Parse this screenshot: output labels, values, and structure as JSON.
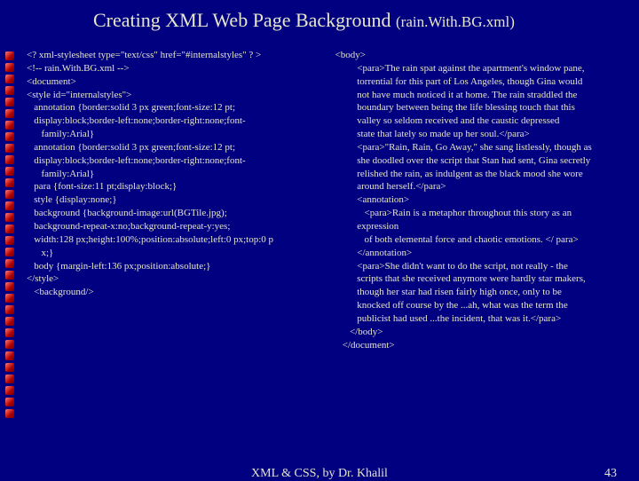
{
  "title_main": "Creating XML Web Page Background ",
  "title_sub": "(rain.With.BG.xml)",
  "left_col": "<? xml-stylesheet type=\"text/css\" href=\"#internalstyles\" ? >\n<!-- rain.With.BG.xml -->\n<document>\n<style id=\"internalstyles\">\n   annotation {border:solid 3 px green;font-size:12 pt;\n   display:block;border-left:none;border-right:none;font-\n      family:Arial}\n   annotation {border:solid 3 px green;font-size:12 pt;\n   display:block;border-left:none;border-right:none;font-\n      family:Arial}\n   para {font-size:11 pt;display:block;}\n   style {display:none;}\n   background {background-image:url(BGTile.jpg);\n   background-repeat-x:no;background-repeat-y:yes;\n   width:128 px;height:100%;position:absolute;left:0 px;top:0 p\n      x;}\n   body {margin-left:136 px;position:absolute;}\n</style>\n   <background/>",
  "right_col": "<body>\n         <para>The rain spat against the apartment's window pane,\n         torrential for this part of Los Angeles, though Gina would\n         not have much noticed it at home. The rain straddled the\n         boundary between being the life blessing touch that this\n         valley so seldom received and the caustic depressed\n         state that lately so made up her soul.</para>\n         <para>\"Rain, Rain, Go Away,\" she sang listlessly, though as\n         she doodled over the script that Stan had sent, Gina secretly\n         relished the rain, as indulgent as the black mood she wore\n         around herself.</para>\n         <annotation>\n            <para>Rain is a metaphor throughout this story as an\n         expression\n            of both elemental force and chaotic emotions. </ para>\n         </annotation>\n         <para>She didn't want to do the script, not really - the\n         scripts that she received anymore were hardly star makers,\n         though her star had risen fairly high once, only to be\n         knocked off course by the ...ah, what was the term the\n         publicist had used ...the incident, that was it.</para>\n      </body>\n   </document>",
  "footer_center": "XML & CSS, by Dr. Khalil",
  "footer_page": "43"
}
